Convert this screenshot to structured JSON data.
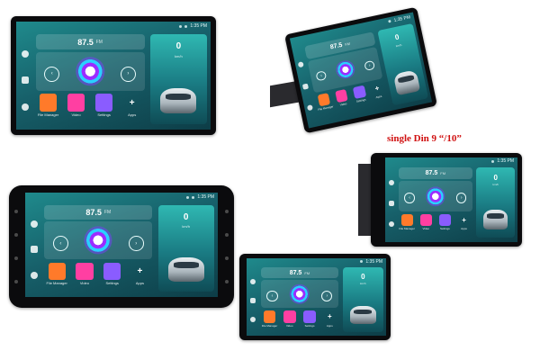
{
  "caption": "single Din 9 “/10”",
  "unit_ui": {
    "status_time": "1:35 PM",
    "radio": {
      "frequency": "87.5",
      "band": "FM"
    },
    "speed": {
      "value": "0",
      "unit": "km/h"
    },
    "apps": [
      {
        "label": "File Manager",
        "icon": "folder-icon"
      },
      {
        "label": "Video",
        "icon": "video-icon"
      },
      {
        "label": "Settings",
        "icon": "settings-icon"
      },
      {
        "label": "Apps",
        "icon": "add-icon"
      }
    ],
    "sidebar_icons": [
      "location-pin-icon",
      "grid-icon",
      "brain-icon"
    ]
  },
  "colors": {
    "screen_teal": "#1f8a8c",
    "caption_red": "#d01010",
    "file_tile": "#ff7a2a",
    "video_tile": "#ff3fa2",
    "settings_tile": "#8a5cff"
  }
}
